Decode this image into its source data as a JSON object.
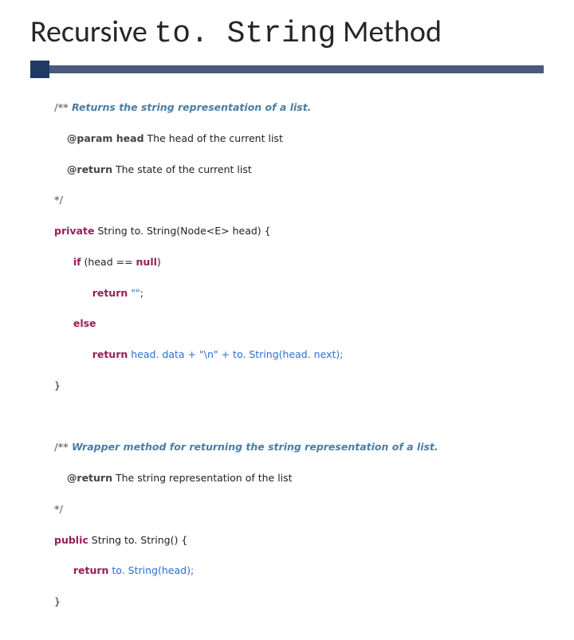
{
  "title": {
    "part1": "Recursive ",
    "mono": "to. String",
    "part2": " Method"
  },
  "code": {
    "l1a": "/** ",
    "l1b": "Returns the string representation of a list.",
    "l2a": "@param head",
    "l2b": " The head of the current list",
    "l3a": "@return",
    "l3b": " The state of the current list",
    "l4": "*/",
    "l5a": "private",
    "l5b": " String to. String(Node<E> head) {",
    "l6a": "if",
    "l6b": " (head == ",
    "l6c": "null",
    "l6d": ")",
    "l7a": "return",
    "l7b": " \"\"",
    "l7c": ";",
    "l8": "else",
    "l9a": "return",
    "l9b": " head. data + ",
    "l9c": "\"\\n\"",
    "l9d": " + to. String(head. next);",
    "l10": "}",
    "l12a": "/** ",
    "l12b": "Wrapper method for returning the string representation of a list.",
    "l13a": "@return",
    "l13b": " The string representation of the list",
    "l14": "*/",
    "l15a": "public",
    "l15b": " String to. String() {",
    "l16a": "return",
    "l16b": " to. String(head);",
    "l17": "}"
  }
}
